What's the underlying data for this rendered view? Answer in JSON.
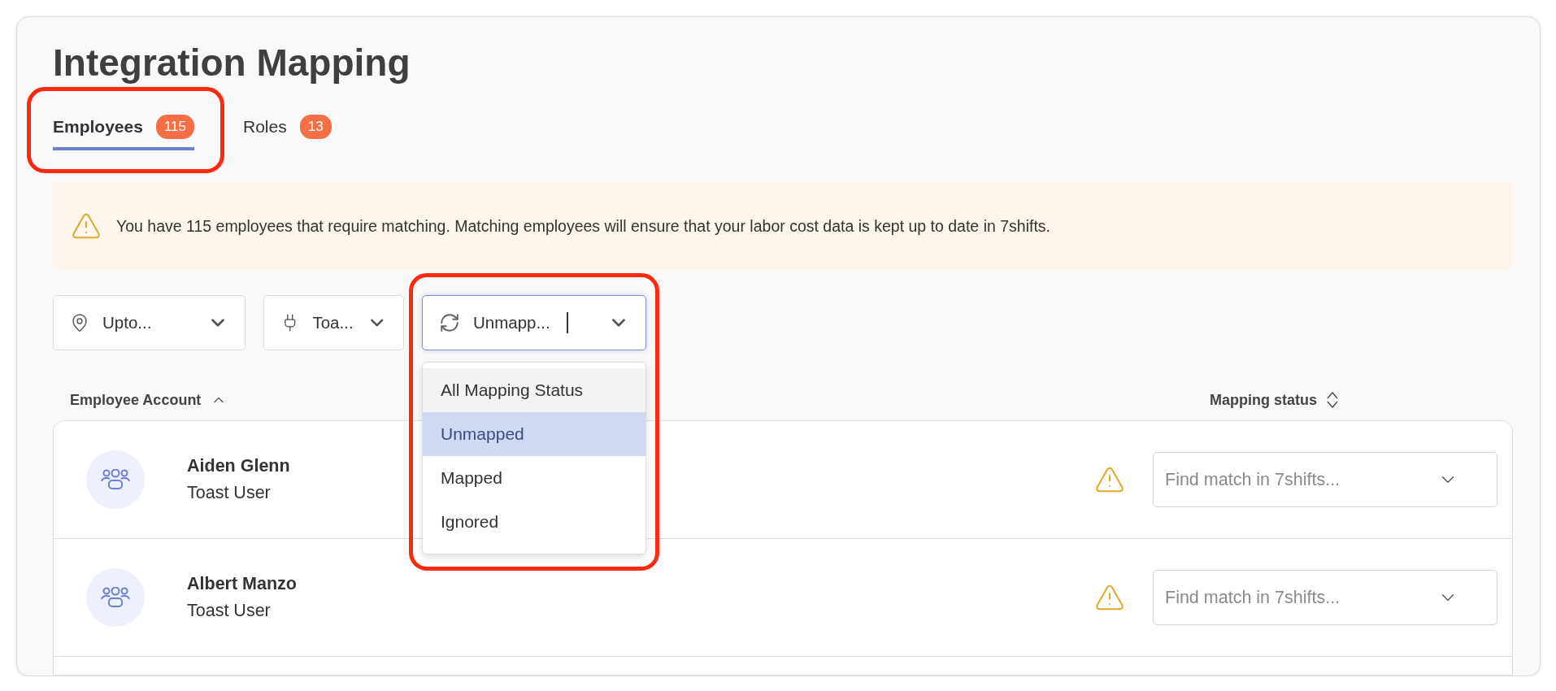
{
  "page": {
    "title": "Integration Mapping"
  },
  "tabs": [
    {
      "label": "Employees",
      "count": "115",
      "selected": true,
      "highlighted": true
    },
    {
      "label": "Roles",
      "count": "13",
      "selected": false,
      "highlighted": false
    }
  ],
  "alert": {
    "kind": "warning",
    "message": "You have 115 employees that require matching. Matching employees will ensure that your labor cost data is kept up to date in 7shifts."
  },
  "filters": [
    {
      "kind": "location",
      "value": "Upto...",
      "focused": false,
      "highlighted": false,
      "expanded": false
    },
    {
      "kind": "integration",
      "value": "Toa...",
      "focused": false,
      "highlighted": false,
      "expanded": false
    },
    {
      "kind": "status",
      "value": "Unmapp...",
      "focused": true,
      "highlighted": true,
      "expanded": true
    }
  ],
  "status_menu": {
    "options": [
      {
        "label": "All Mapping Status",
        "selected": false,
        "hovered": true
      },
      {
        "label": "Unmapped",
        "selected": true,
        "hovered": false
      },
      {
        "label": "Mapped",
        "selected": false,
        "hovered": false
      },
      {
        "label": "Ignored",
        "selected": false,
        "hovered": false
      }
    ]
  },
  "columns": [
    {
      "label": "Employee Account",
      "sorted_ascending": true
    },
    {
      "label": "Mapping status",
      "sorted_ascending": false
    }
  ],
  "rows": [
    {
      "name": "Aiden Glenn",
      "source": "Toast User",
      "warning": true,
      "match_placeholder": "Find match in 7shifts..."
    },
    {
      "name": "Albert Manzo",
      "source": "Toast User",
      "warning": true,
      "match_placeholder": "Find match in 7shifts..."
    }
  ]
}
